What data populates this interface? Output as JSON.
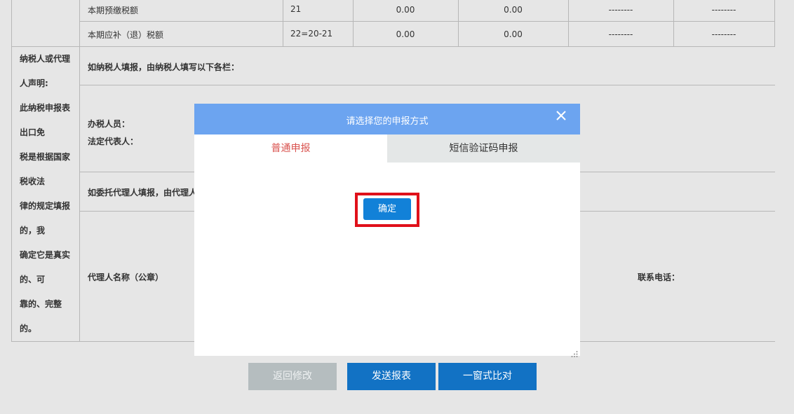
{
  "table": {
    "rows": [
      {
        "label": "本期预缴税额",
        "formula": "21",
        "v1": "0.00",
        "v2": "0.00",
        "v3": "--------",
        "v4": "--------"
      },
      {
        "label": "本期应补（退）税额",
        "formula": "22=20-21",
        "v1": "0.00",
        "v2": "0.00",
        "v3": "--------",
        "v4": "--------"
      }
    ]
  },
  "declaration": {
    "left_lines": [
      "纳税人或代理",
      "人声明:",
      "此纳税申报表",
      "出口免",
      "税是根据国家",
      "税收法",
      "律的规定填报",
      "的，我",
      "确定它是真实",
      "的、可",
      "靠的、完整",
      "的。"
    ],
    "taxpayer_section": "如纳税人填报，由纳税人填写以下各栏：",
    "handler_label": "办税人员：",
    "legal_rep_label": "法定代表人：",
    "agent_section": "如委托代理人填报，由代理人",
    "agent_name_label": "代理人名称（公章）",
    "phone_label": "联系电话："
  },
  "modal": {
    "title": "请选择您的申报方式",
    "tabs": [
      {
        "label": "普通申报",
        "active": true
      },
      {
        "label": "短信验证码申报",
        "active": false
      }
    ],
    "confirm_label": "确定"
  },
  "buttons": {
    "back": "返回修改",
    "send": "发送报表",
    "compare": "一窗式比对"
  },
  "colors": {
    "header_blue": "#6ca4f0",
    "button_blue": "#1281d8",
    "highlight_red": "#e0101a",
    "disabled_gray": "#b5bdbf",
    "active_tab_text": "#d9534f"
  }
}
